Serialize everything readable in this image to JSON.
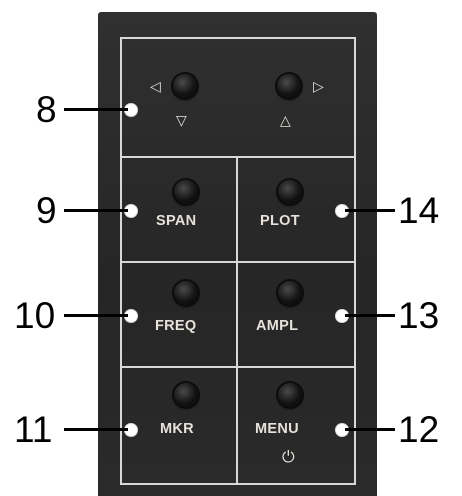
{
  "keys": {
    "left": {
      "left_arrow": "◁",
      "down_arrow": "▽"
    },
    "right": {
      "right_arrow": "▷",
      "up_arrow": "△"
    },
    "span": "SPAN",
    "plot": "PLOT",
    "freq": "FREQ",
    "ampl": "AMPL",
    "mkr": "MKR",
    "menu": "MENU",
    "power_symbol": "⏻"
  },
  "callouts": {
    "c8": "8",
    "c9": "9",
    "c10": "10",
    "c11": "11",
    "c12": "12",
    "c13": "13",
    "c14": "14"
  },
  "colors": {
    "panel": "#2b2b2b",
    "grid_lines": "#d8d8d8",
    "label_text": "#e6e1da",
    "callout_text": "#000000"
  }
}
